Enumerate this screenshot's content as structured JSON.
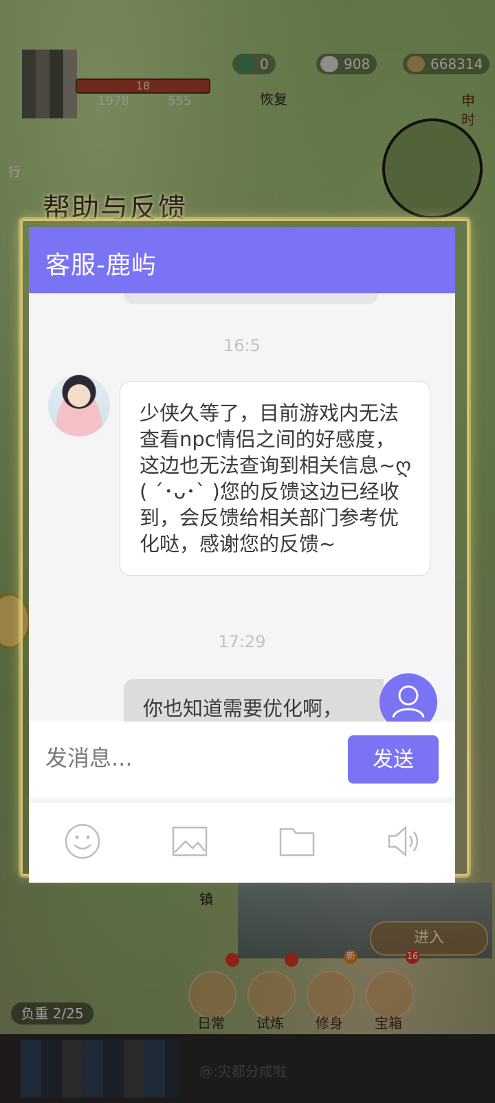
{
  "hud": {
    "jade_count": "0",
    "silver_count": "908",
    "copper_count": "668314",
    "level_text": "18",
    "stat_one": "1978",
    "stat_two": "555",
    "restore_label": "恢复",
    "shichen_label": "申时",
    "side_label": "行"
  },
  "dialog": {
    "section_title": "帮助与反馈",
    "header_title": "客服-鹿屿",
    "messages": [
      {
        "timestamp": "16:5",
        "sender": "agent",
        "text": "少侠久等了，目前游戏内无法查看npc情侣之间的好感度，这边也无法查询到相关信息~ღ( ´･ᴗ･` )您的反馈这边已经收到，会反馈给相关部门参考优化哒，感谢您的反馈~"
      },
      {
        "timestamp": "17:29",
        "sender": "user",
        "text": "你也知道需要优化啊，"
      }
    ],
    "input_placeholder": "发消息...",
    "send_label": "发送",
    "toolbar_icons": [
      "emoji-icon",
      "image-icon",
      "folder-icon",
      "speaker-icon"
    ]
  },
  "game_ui": {
    "town_label": "镇",
    "enter_label": "进入",
    "load_label": "负重 2/25",
    "buttons": [
      {
        "label": "日常",
        "badge": ""
      },
      {
        "label": "试炼",
        "badge": ""
      },
      {
        "label": "修身",
        "badge": "新"
      },
      {
        "label": "宝箱",
        "badge": "16"
      }
    ],
    "bottom_text": "@:灾都分成啦"
  },
  "colors": {
    "accent": "#7a73f3",
    "panel_bg": "#f5f5f5",
    "bubble_out": "#dcdcdc"
  }
}
